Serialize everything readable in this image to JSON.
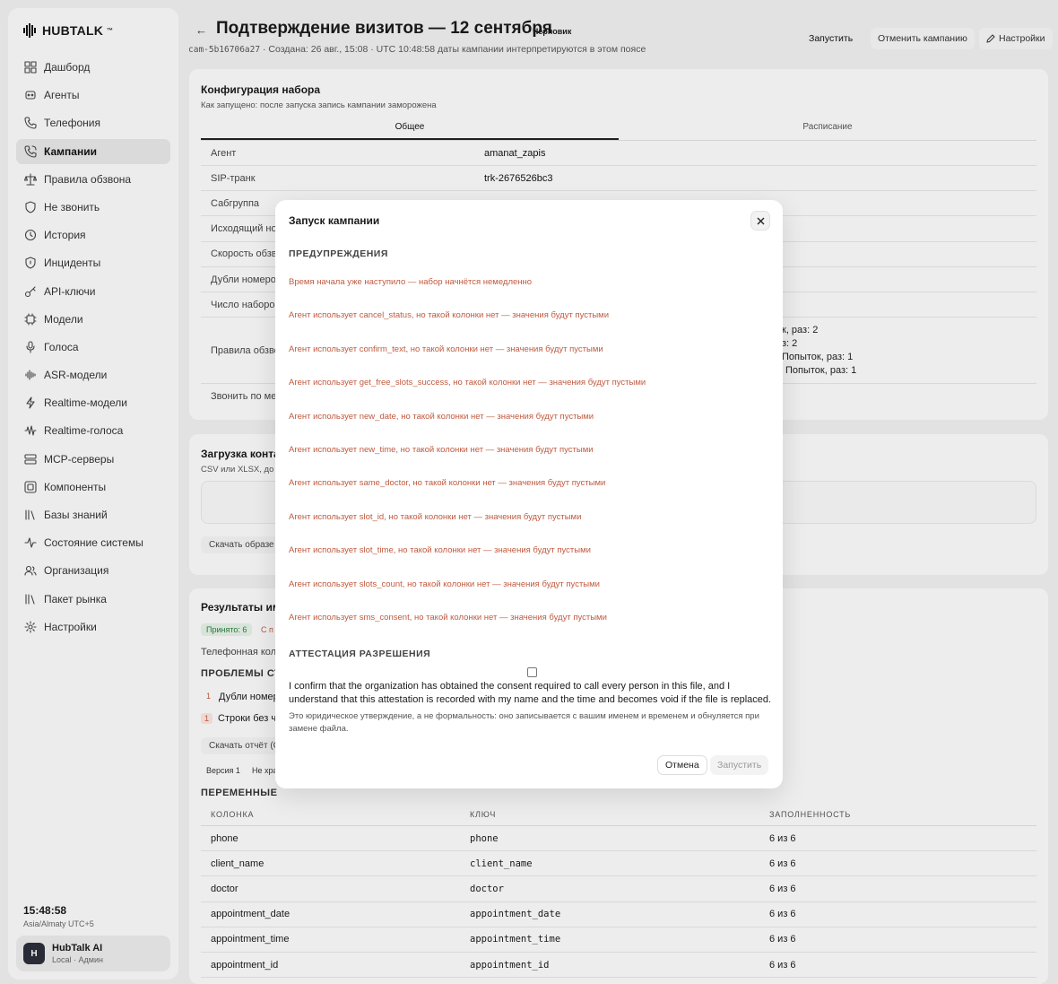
{
  "app": {
    "brand": "HUBTALK",
    "brand_mark": "™"
  },
  "sidebar": {
    "items": [
      {
        "label": "Дашборд",
        "icon": "dashboard-icon"
      },
      {
        "label": "Агенты",
        "icon": "agents-icon"
      },
      {
        "label": "Телефония",
        "icon": "phone-icon"
      },
      {
        "label": "Кампании",
        "icon": "campaign-icon",
        "active": true
      },
      {
        "label": "Правила обзвона",
        "icon": "scale-icon"
      },
      {
        "label": "Не звонить",
        "icon": "shield-icon"
      },
      {
        "label": "История",
        "icon": "history-icon"
      },
      {
        "label": "Инциденты",
        "icon": "incident-shield-icon"
      },
      {
        "label": "API-ключи",
        "icon": "key-icon"
      },
      {
        "label": "Модели",
        "icon": "chip-icon"
      },
      {
        "label": "Голоса",
        "icon": "mic-icon"
      },
      {
        "label": "ASR-модели",
        "icon": "waveform-icon"
      },
      {
        "label": "Realtime-модели",
        "icon": "bolt-icon"
      },
      {
        "label": "Realtime-голоса",
        "icon": "voice-wave-icon"
      },
      {
        "label": "MCP-серверы",
        "icon": "server-icon"
      },
      {
        "label": "Компоненты",
        "icon": "components-icon"
      },
      {
        "label": "Базы знаний",
        "icon": "library-icon"
      },
      {
        "label": "Состояние системы",
        "icon": "activity-icon"
      },
      {
        "label": "Организация",
        "icon": "users-icon"
      },
      {
        "label": "Пакет рынка",
        "icon": "package-icon"
      },
      {
        "label": "Настройки",
        "icon": "gear-icon"
      }
    ],
    "clock": {
      "time": "15:48:58",
      "zone": "Asia/Almaty UTC+5"
    },
    "user": {
      "initial": "H",
      "name": "HubTalk AI",
      "role": "Local · Админ"
    }
  },
  "header": {
    "back": "←",
    "title": "Подтверждение визитов — 12 сентября",
    "status": "Черновик",
    "campaign_id": "cam-5b16706a27",
    "meta": "· Создана: 26 авг., 15:08 · UTC 10:48:58 даты кампании интерпретируются в этом поясе",
    "launch": "Запустить",
    "cancel": "Отменить кампанию",
    "settings": "Настройки"
  },
  "config": {
    "title": "Конфигурация набора",
    "subtitle": "Как запущено: после запуска запись кампании заморожена",
    "tabs": [
      "Общее",
      "Расписание"
    ],
    "rows": [
      {
        "k": "Агент",
        "v": "amanat_zapis"
      },
      {
        "k": "SIP-транк",
        "v": "trk-2676526bc3"
      },
      {
        "k": "Сабгруппа",
        "v": ""
      },
      {
        "k": "Исходящий но",
        "v": ""
      },
      {
        "k": "Скорость обзв",
        "v": ""
      },
      {
        "k": "Дубли номеров",
        "v": ""
      },
      {
        "k": "Число наборов",
        "v": ""
      }
    ],
    "rules_label": "Правила обзво",
    "rules_values": [
      "к, раз: 2",
      "з: 2",
      "Попыток, раз: 1",
      "Попыток, раз: 1"
    ],
    "call_label": "Звонить по ме"
  },
  "upload": {
    "title": "Загрузка конта",
    "subtitle": "CSV или XLSX, до 5",
    "download_sample": "Скачать образе"
  },
  "results": {
    "title": "Результаты им",
    "accepted": "Принято: 6",
    "partial": "С п",
    "phone_col": "Телефонная коло",
    "problems_h": "ПРОБЛЕМЫ СТР",
    "problems": [
      {
        "count": "1",
        "label": "Дубли номер"
      },
      {
        "count": "1",
        "label": "Строки без ч"
      }
    ],
    "download_report": "Скачать отчёт (С",
    "version": "Версия 1",
    "not_stored": "Не хра"
  },
  "variables": {
    "title": "ПЕРЕМЕННЫЕ",
    "headers": [
      "КОЛОНКА",
      "КЛЮЧ",
      "ЗАПОЛНЕННОСТЬ"
    ],
    "rows": [
      {
        "col": "phone",
        "key": "phone",
        "fill": "6 из 6"
      },
      {
        "col": "client_name",
        "key": "client_name",
        "fill": "6 из 6"
      },
      {
        "col": "doctor",
        "key": "doctor",
        "fill": "6 из 6"
      },
      {
        "col": "appointment_date",
        "key": "appointment_date",
        "fill": "6 из 6"
      },
      {
        "col": "appointment_time",
        "key": "appointment_time",
        "fill": "6 из 6"
      },
      {
        "col": "appointment_id",
        "key": "appointment_id",
        "fill": "6 из 6"
      }
    ]
  },
  "modal": {
    "title": "Запуск кампании",
    "warnings_title": "ПРЕДУПРЕЖДЕНИЯ",
    "warnings": [
      "Время начала уже наступило — набор начнётся немедленно",
      "Агент использует cancel_status, но такой колонки нет — значения будут пустыми",
      "Агент использует confirm_text, но такой колонки нет — значения будут пустыми",
      "Агент использует get_free_slots_success, но такой колонки нет — значения будут пустыми",
      "Агент использует new_date, но такой колонки нет — значения будут пустыми",
      "Агент использует new_time, но такой колонки нет — значения будут пустыми",
      "Агент использует same_doctor, но такой колонки нет — значения будут пустыми",
      "Агент использует slot_id, но такой колонки нет — значения будут пустыми",
      "Агент использует slot_time, но такой колонки нет — значения будут пустыми",
      "Агент использует slots_count, но такой колонки нет — значения будут пустыми",
      "Агент использует sms_consent, но такой колонки нет — значения будут пустыми"
    ],
    "attestation_title": "АТТЕСТАЦИЯ РАЗРЕШЕНИЯ",
    "attestation_text": "I confirm that the organization has obtained the consent required to call every person in this file, and I understand that this attestation is recorded with my name and the time and becomes void if the file is replaced.",
    "attestation_note": "Это юридическое утверждение, а не формальность: оно записывается с вашим именем и временем и обнуляется при замене файла.",
    "cancel": "Отмена",
    "launch": "Запустить"
  }
}
